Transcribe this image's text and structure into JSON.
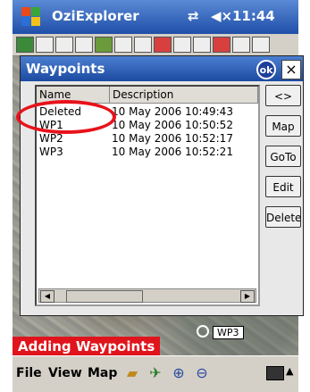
{
  "status_bar": {
    "app_title": "OziExplorer",
    "signal_icon": "antenna-icon",
    "speaker_glyph": "◀×",
    "clock": "11:44"
  },
  "dialog": {
    "title": "Waypoints",
    "ok_label": "ok",
    "close_label": "×",
    "columns": [
      "Name",
      "Description"
    ],
    "rows": [
      {
        "name": "Deleted",
        "description": "10 May 2006 10:49:43"
      },
      {
        "name": "WP1",
        "description": "10 May 2006 10:50:52"
      },
      {
        "name": "WP2",
        "description": "10 May 2006 10:52:17"
      },
      {
        "name": "WP3",
        "description": "10 May 2006 10:52:21"
      }
    ],
    "buttons": {
      "swap": "<>",
      "map": "Map",
      "goto": "GoTo",
      "edit": "Edit",
      "delete": "Delete"
    },
    "highlight_color": "#e8121a"
  },
  "map": {
    "waypoint_label": "WP3",
    "caption": "Adding Waypoints"
  },
  "menu_bar": {
    "file": "File",
    "view": "View",
    "map": "Map",
    "icons": [
      "folder-icon",
      "gps-icon",
      "zoom-in-icon",
      "zoom-out-icon",
      "keyboard-icon"
    ]
  },
  "colors": {
    "title_bar": "#1f4fa8",
    "caption_bg": "#e0141c"
  }
}
